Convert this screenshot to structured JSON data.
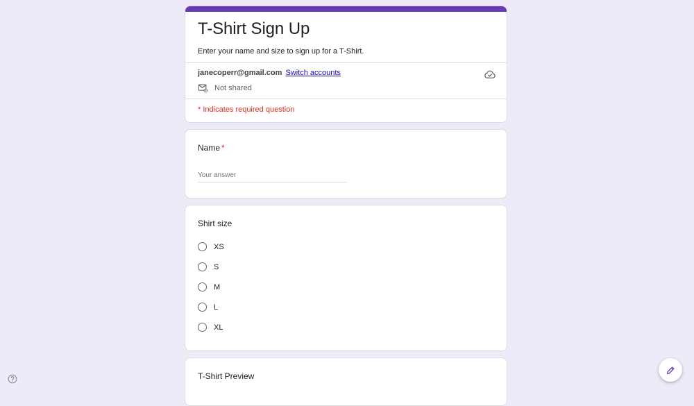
{
  "form": {
    "title": "T-Shirt Sign Up",
    "description": "Enter your name and size to sign up for a T-Shirt.",
    "accent_color": "#673ab7"
  },
  "account": {
    "email": "janecoperr@gmail.com",
    "switch_label": "Switch accounts",
    "shared_status": "Not shared",
    "icons": [
      "cloud-icon",
      "mail-icon"
    ]
  },
  "required_note": "* Indicates required question",
  "questions": {
    "name": {
      "title": "Name",
      "required_mark": "*",
      "placeholder": "Your answer"
    },
    "shirt_size": {
      "title": "Shirt size",
      "options": [
        "XS",
        "S",
        "M",
        "L",
        "XL"
      ]
    },
    "preview": {
      "title": "T-Shirt Preview"
    }
  },
  "footer": {
    "icons": [
      "help-icon",
      "pencil-icon"
    ]
  }
}
